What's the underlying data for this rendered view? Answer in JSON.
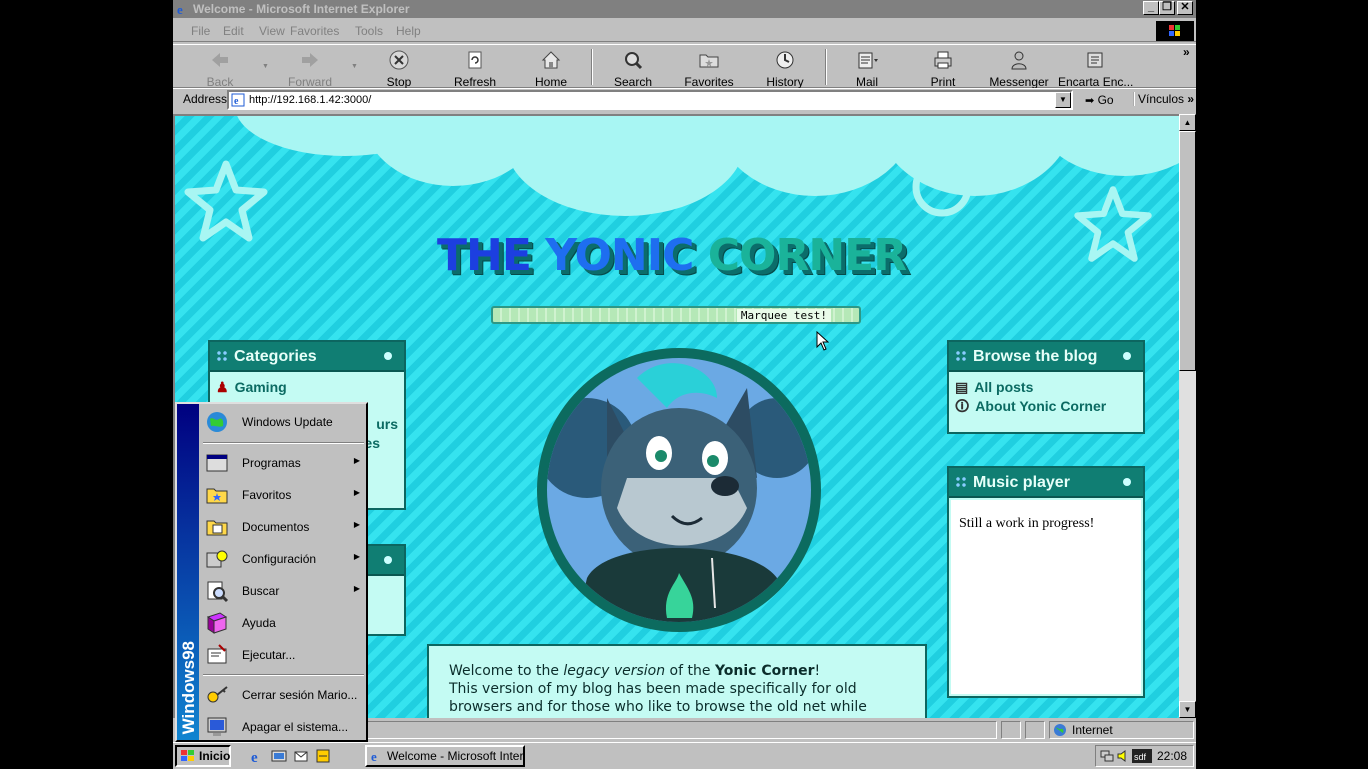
{
  "window": {
    "title": "Welcome - Microsoft Internet Explorer",
    "controls": {
      "minimize": "_",
      "maximize": "❐",
      "close": "✕"
    }
  },
  "menubar": {
    "items": [
      {
        "label": "File"
      },
      {
        "label": "Edit"
      },
      {
        "label": "View"
      },
      {
        "label": "Favorites"
      },
      {
        "label": "Tools"
      },
      {
        "label": "Help"
      }
    ]
  },
  "toolbar": {
    "back": "Back",
    "forward": "Forward",
    "stop": "Stop",
    "refresh": "Refresh",
    "home": "Home",
    "search": "Search",
    "favorites": "Favorites",
    "history": "History",
    "mail": "Mail",
    "print": "Print",
    "messenger": "Messenger",
    "encarta": "Encarta Enc...",
    "overflow": "»"
  },
  "addressbar": {
    "label": "Address",
    "url": "http://192.168.1.42:3000/",
    "go": "Go",
    "links": "Vínculos",
    "links_more": "»"
  },
  "page": {
    "site_title": {
      "w1": "THE",
      "w2": "YONIC",
      "w3": "CORNER"
    },
    "marquee": "Marquee test!",
    "categories": {
      "title": "Categories",
      "items": [
        {
          "label": "Gaming"
        },
        {
          "label": "urs"
        },
        {
          "label": "es"
        }
      ]
    },
    "browse": {
      "title": "Browse the blog",
      "items": [
        {
          "label": "All posts"
        },
        {
          "label": "About Yonic Corner"
        }
      ]
    },
    "music": {
      "title": "Music player",
      "body": "Still a work in progress!"
    },
    "welcome": {
      "p1_a": "Welcome to the ",
      "p1_em": "legacy version",
      "p1_b": " of the ",
      "p1_strong": "Yonic Corner",
      "p1_c": "!",
      "p2": "This version of my blog has been made specifically for old",
      "p3": "browsers and for those who like to browse the old net while"
    }
  },
  "statusbar": {
    "zone": "Internet"
  },
  "taskbar": {
    "start": "Inicio",
    "task": "Welcome - Microsoft Intern...",
    "clock": "22:08"
  },
  "startmenu": {
    "banner": "Windows98",
    "items": [
      {
        "label": "Windows Update"
      },
      {
        "label": "Programas"
      },
      {
        "label": "Favoritos"
      },
      {
        "label": "Documentos"
      },
      {
        "label": "Configuración"
      },
      {
        "label": "Buscar"
      },
      {
        "label": "Ayuda"
      },
      {
        "label": "Ejecutar..."
      },
      {
        "label": "Cerrar sesión Mario..."
      },
      {
        "label": "Apagar el sistema..."
      }
    ]
  },
  "colors": {
    "sky": "#35e3ef",
    "panel_head": "#107e73",
    "panel_bg": "#c4fbf3",
    "win_gray": "#c0c0c0"
  }
}
